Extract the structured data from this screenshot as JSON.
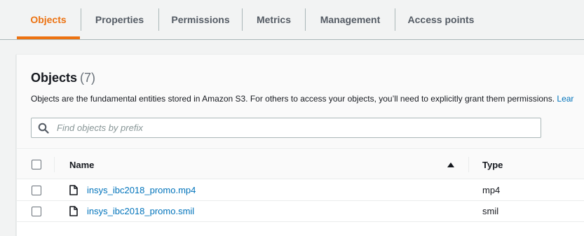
{
  "tabs": [
    {
      "label": "Objects",
      "active": true
    },
    {
      "label": "Properties",
      "active": false
    },
    {
      "label": "Permissions",
      "active": false
    },
    {
      "label": "Metrics",
      "active": false
    },
    {
      "label": "Management",
      "active": false
    },
    {
      "label": "Access points",
      "active": false
    }
  ],
  "panel": {
    "title": "Objects",
    "count": "(7)",
    "description": "Objects are the fundamental entities stored in Amazon S3. For others to access your objects, you’ll need to explicitly grant them permissions.",
    "learn_more": "Lear"
  },
  "search": {
    "placeholder": "Find objects by prefix",
    "value": "",
    "icon": "search-icon"
  },
  "table": {
    "columns": {
      "name": "Name",
      "type": "Type"
    },
    "sort": {
      "column": "name",
      "direction": "ascending",
      "icon": "sort-ascending-icon"
    },
    "rows": [
      {
        "name": "insys_ibc2018_promo.mp4",
        "type": "mp4",
        "icon": "file-icon"
      },
      {
        "name": "insys_ibc2018_promo.smil",
        "type": "smil",
        "icon": "file-icon"
      }
    ]
  },
  "colors": {
    "accent": "#ec7211",
    "link": "#0073bb",
    "text": "#16191f",
    "muted": "#545b64"
  }
}
